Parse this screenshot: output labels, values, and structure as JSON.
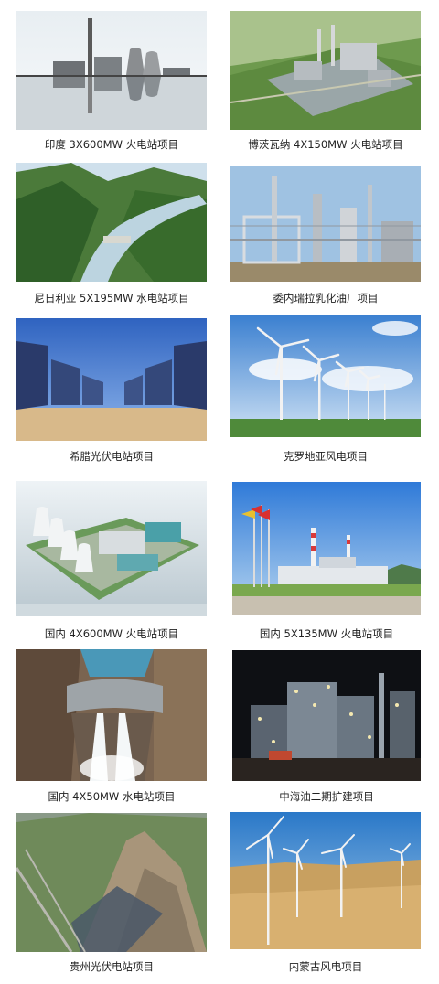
{
  "projects": [
    {
      "caption": "印度  3X600MW  火电站项目",
      "scene": "thermal-plant-reflection"
    },
    {
      "caption": "博茨瓦纳  4X150MW  火电站项目",
      "scene": "aerial-plant-rendering"
    },
    {
      "caption": "尼日利亚  5X195MW 水电站项目",
      "scene": "river-valley-dam"
    },
    {
      "caption": "委内瑞拉乳化油厂项目",
      "scene": "refinery"
    },
    {
      "caption": "希腊光伏电站项目",
      "scene": "solar-panels"
    },
    {
      "caption": "克罗地亚风电项目",
      "scene": "wind-farm-green"
    },
    {
      "caption": "国内  4X600MW  火电站项目",
      "scene": "plant-rendering-cooling-towers"
    },
    {
      "caption": "国内  5X135MW  火电站项目",
      "scene": "plant-with-flags"
    },
    {
      "caption": "国内  4X50MW 水电站项目",
      "scene": "hydro-dam-spillway"
    },
    {
      "caption": "中海油二期扩建项目",
      "scene": "refinery-night"
    },
    {
      "caption": "贵州光伏电站项目",
      "scene": "mountain-solar"
    },
    {
      "caption": "内蒙古风电项目",
      "scene": "wind-farm-desert"
    }
  ]
}
